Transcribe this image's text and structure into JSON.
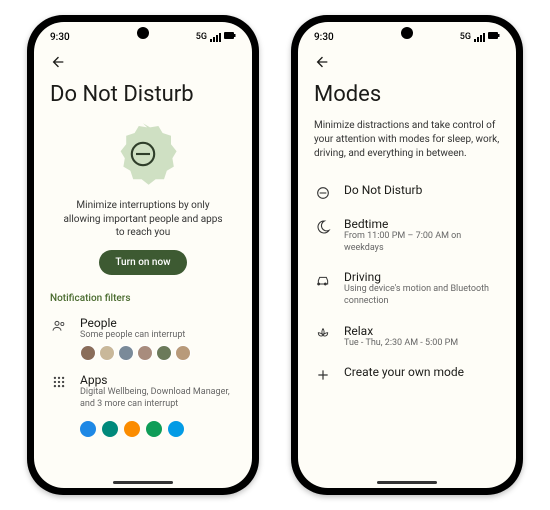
{
  "status": {
    "time": "9:30",
    "network": "5G"
  },
  "dnd": {
    "title": "Do Not Disturb",
    "hero_text": "Minimize interruptions by only allowing important people and apps to reach you",
    "cta": "Turn on now",
    "filters_label": "Notification filters",
    "people": {
      "title": "People",
      "sub": "Some people can interrupt"
    },
    "apps": {
      "title": "Apps",
      "sub": "Digital Wellbeing, Download Manager, and 3 more can interrupt"
    },
    "avatars": [
      "#8a6d5a",
      "#c9b89a",
      "#7a8a99",
      "#a88c7d",
      "#6b7a5a",
      "#b89a7a"
    ],
    "app_colors": [
      "#1e88e5",
      "#00897b",
      "#fb8c00",
      "#0f9d58",
      "#039be5"
    ]
  },
  "modes": {
    "title": "Modes",
    "desc": "Minimize distractions and take control of your attention with modes for sleep, work, driving, and everything in between.",
    "items": [
      {
        "icon": "dnd",
        "title": "Do Not Disturb",
        "sub": ""
      },
      {
        "icon": "moon",
        "title": "Bedtime",
        "sub": "From 11:00 PM – 7:00 AM on weekdays"
      },
      {
        "icon": "car",
        "title": "Driving",
        "sub": "Using device's motion and Bluetooth connection"
      },
      {
        "icon": "lotus",
        "title": "Relax",
        "sub": "Tue - Thu, 2:30 AM - 5:00 PM"
      },
      {
        "icon": "plus",
        "title": "Create your own mode",
        "sub": ""
      }
    ]
  }
}
